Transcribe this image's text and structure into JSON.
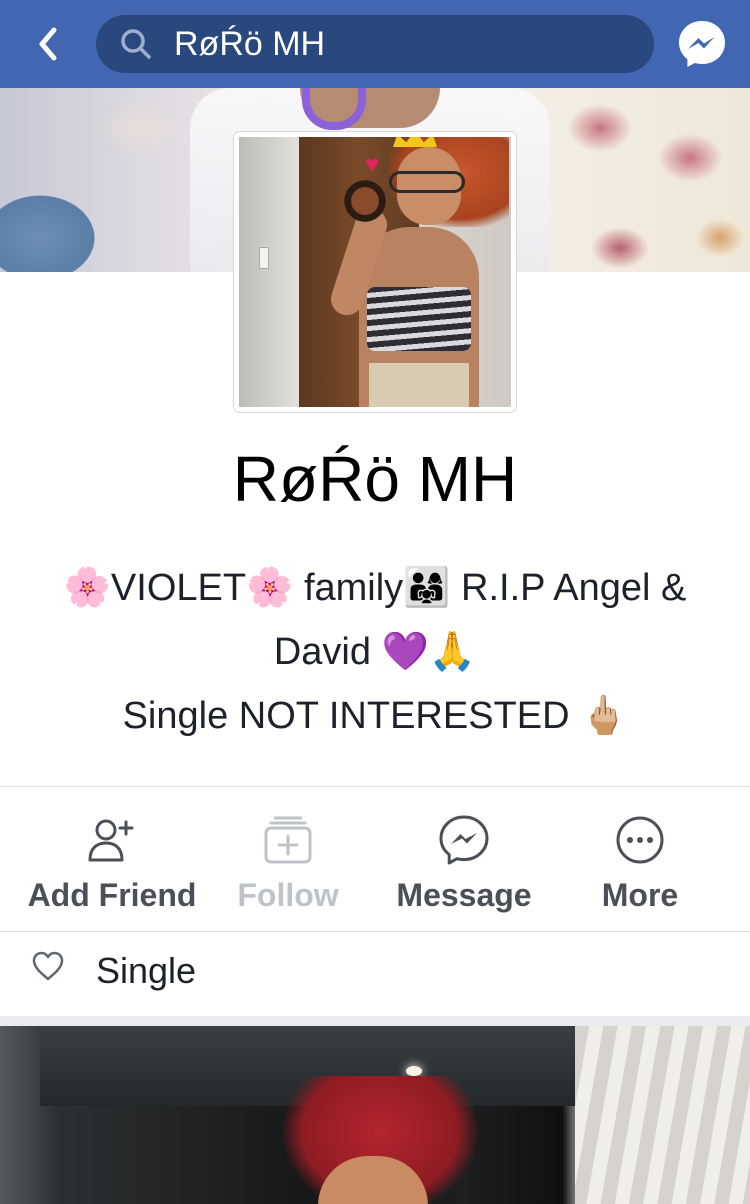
{
  "nav": {
    "search_value": "RøŔö MH",
    "icons": [
      "back-chevron-icon",
      "search-icon",
      "messenger-icon"
    ],
    "bar_color": "#4267b2",
    "search_bg": "#29487d"
  },
  "profile": {
    "name": "RøŔö MH",
    "bio_lines": [
      "🌸VIOLET🌸 family👨‍👩‍👧 R.I.P Angel &",
      "David 💜🙏",
      "Single NOT INTERESTED 🖕🏼"
    ]
  },
  "actions": [
    {
      "label": "Add Friend",
      "icon": "add-friend-icon",
      "enabled": true
    },
    {
      "label": "Follow",
      "icon": "follow-icon",
      "enabled": false
    },
    {
      "label": "Message",
      "icon": "messenger-icon",
      "enabled": true
    },
    {
      "label": "More",
      "icon": "more-dots-icon",
      "enabled": true
    }
  ],
  "relationship": {
    "icon": "heart-outline-icon",
    "text": "Single"
  },
  "colors": {
    "action_text": "#4b4f56",
    "disabled_text": "#bec3c9",
    "divider": "#dadde1"
  }
}
